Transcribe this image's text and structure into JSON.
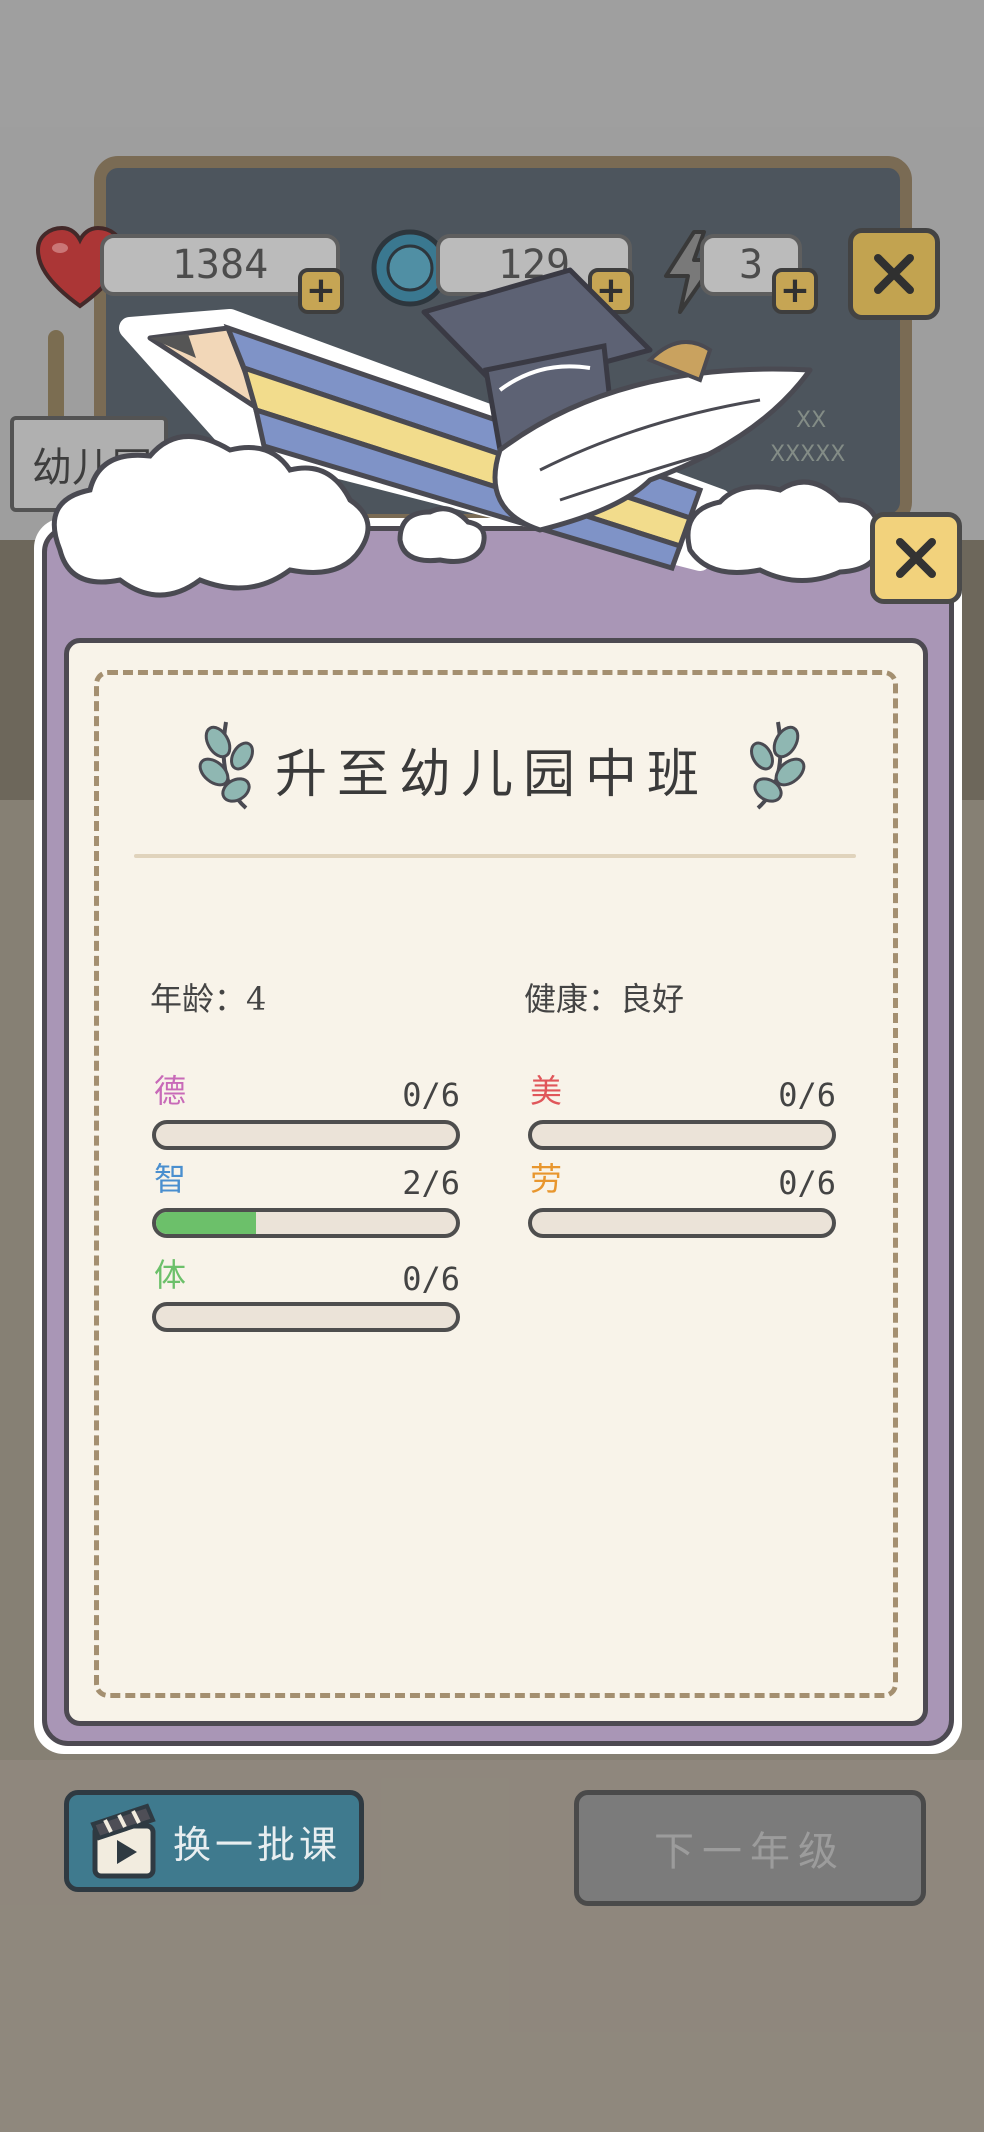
{
  "resources": {
    "hearts": "1384",
    "coins": "129",
    "energy": "3",
    "plus": "+"
  },
  "background": {
    "sign_text": "幼儿园",
    "board_lines": [
      "XX",
      "XXXXX"
    ]
  },
  "panel": {
    "title": "升至幼儿园中班",
    "age_label": "年龄：4",
    "health_label": "健康：良好"
  },
  "stats": [
    {
      "name": "德",
      "value": "0/6",
      "progress": 0,
      "color": "#c86ab8"
    },
    {
      "name": "美",
      "value": "0/6",
      "progress": 0,
      "color": "#e0565a"
    },
    {
      "name": "智",
      "value": "2/6",
      "progress": 0.333,
      "color": "#4a8fcf"
    },
    {
      "name": "劳",
      "value": "0/6",
      "progress": 0,
      "color": "#e8962e"
    },
    {
      "name": "体",
      "value": "0/6",
      "progress": 0,
      "color": "#6cc06a"
    }
  ],
  "buttons": {
    "swap_courses": "换一批课",
    "next_grade": "下一年级"
  },
  "colors": {
    "panel_purple": "#a996b6",
    "panel_cream": "#f8f3e9",
    "close_yellow": "#e4bf5a",
    "swap_blue": "#3f7a8e",
    "disabled_gray": "#7b7b7b",
    "progress_green": "#6cc06a"
  },
  "icons": [
    "heart-icon",
    "coin-icon",
    "lightning-icon",
    "close-icon",
    "pencil-icon",
    "graduation-cap-icon",
    "wing-icon",
    "cloud-icon",
    "laurel-icon",
    "clapperboard-play-icon"
  ]
}
